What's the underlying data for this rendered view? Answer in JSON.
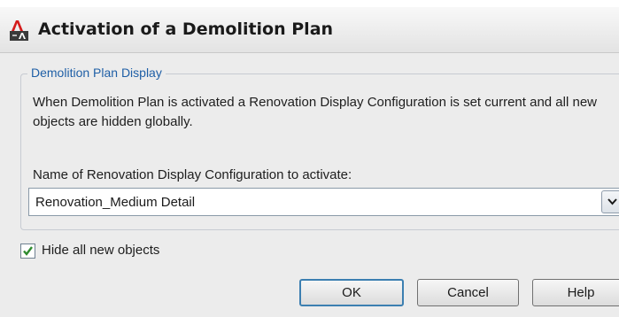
{
  "dialog": {
    "title": "Activation of a Demolition Plan",
    "app_icon": "autodesk-architecture-icon",
    "group": {
      "legend": "Demolition Plan Display",
      "description": "When Demolition Plan is activated a Renovation Display Configuration is set current and all new objects are hidden globally.",
      "combo_label": "Name of Renovation Display Configuration to activate:",
      "combo_value": "Renovation_Medium Detail"
    },
    "checkbox": {
      "label": "Hide all new objects",
      "checked": true
    },
    "buttons": {
      "ok": "OK",
      "cancel": "Cancel",
      "help": "Help"
    }
  },
  "colors": {
    "legend_text": "#1f5fa6",
    "dialog_bg": "#ececec",
    "checkmark": "#2e8b2e",
    "focus_border": "#3c7fb1"
  }
}
